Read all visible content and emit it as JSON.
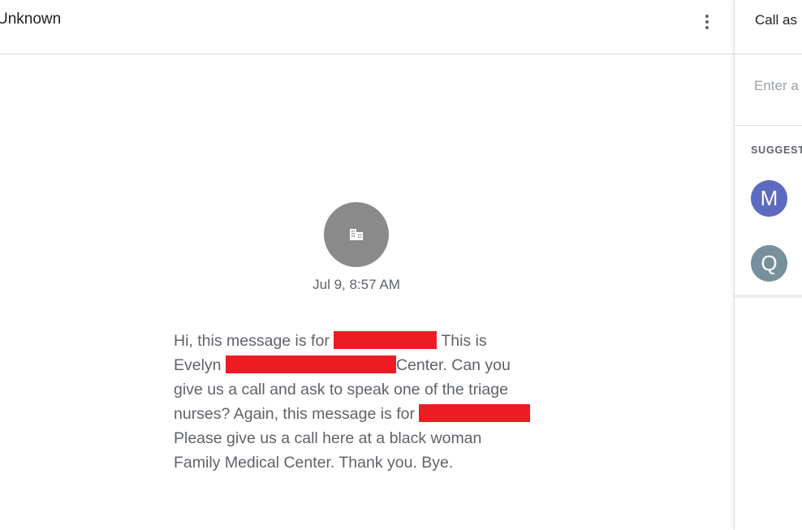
{
  "header": {
    "title": "Unknown",
    "more_icon": "more-vert-icon"
  },
  "voicemail": {
    "avatar_icon": "business-icon",
    "avatar_color": "#8a8a8a",
    "timestamp": "Jul 9, 8:57 AM",
    "transcript": {
      "line1_a": "Hi, this message is for",
      "line1_b": "This is",
      "line2_a": "Evelyn",
      "line2_b": "Center. Can you",
      "line3": "give us a call and ask to speak one of the triage",
      "line4_a": "nurses? Again, this message is for",
      "line5": "Please give us a call here at a black woman",
      "line6": "Family Medical Center. Thank you. Bye."
    },
    "redaction_color": "#ed1c24"
  },
  "side_panel": {
    "title": "Call as",
    "search_placeholder": "Enter a",
    "suggestions_label": "SUGGEST",
    "contacts": [
      {
        "initial": "M",
        "color": "#5c6bc0"
      },
      {
        "initial": "Q",
        "color": "#78909c"
      }
    ]
  }
}
